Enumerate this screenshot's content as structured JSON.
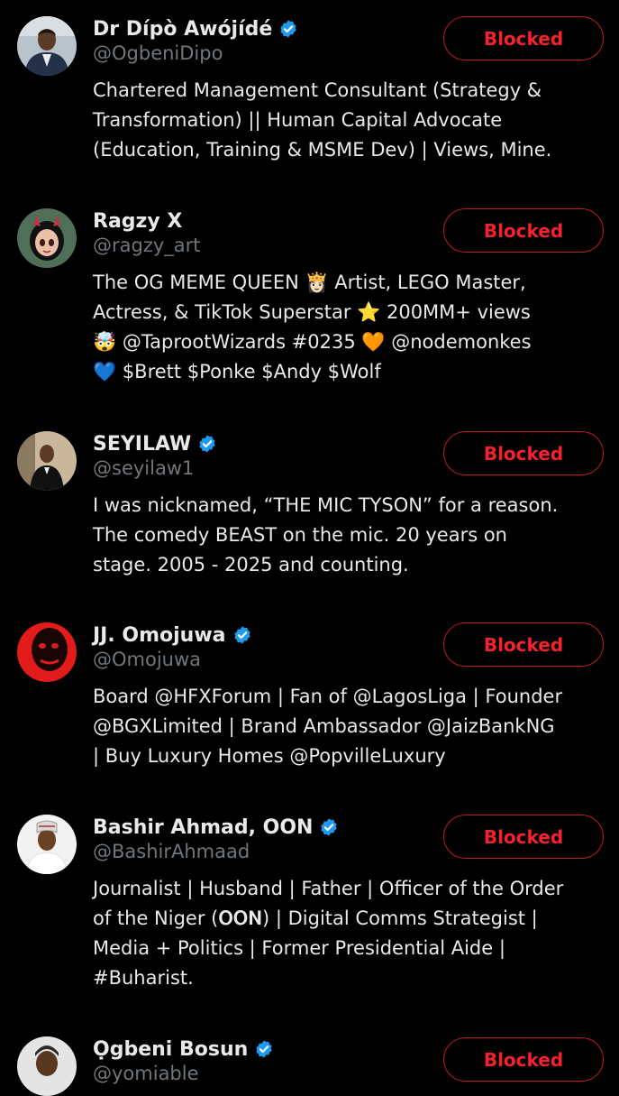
{
  "button_label": "Blocked",
  "accent_color": "#f4212e",
  "verified_color": "#1d9bf0",
  "accounts": [
    {
      "name": "Dr Dípò Awójídé",
      "handle": "@OgbeniDipo",
      "verified": true,
      "bio": "Chartered Management Consultant (Strategy &\nTransformation) || Human Capital Advocate\n(Education, Training & MSME Dev) | Views, Mine."
    },
    {
      "name": "Ragzy X",
      "handle": "@ragzy_art",
      "verified": false,
      "bio": "The OG MEME QUEEN 👸🏻 Artist, LEGO Master,\nActress, & TikTok Superstar ⭐ 200MM+ views\n🤯 @TaprootWizards #0235 🧡 @nodemonkes\n💙 $Brett $Ponke $Andy $Wolf"
    },
    {
      "name": "SEYILAW",
      "handle": "@seyilaw1",
      "verified": true,
      "bio": "I was nicknamed, “THE MIC TYSON” for a reason.\nThe comedy BEAST on the mic. 20 years on\nstage. 2005 - 2025 and counting."
    },
    {
      "name": "JJ. Omojuwa",
      "handle": "@Omojuwa",
      "verified": true,
      "bio": "Board @HFXForum | Fan of @LagosLiga | Founder\n@BGXLimited | Brand Ambassador @JaizBankNG\n| Buy Luxury Homes @PopvilleLuxury"
    },
    {
      "name": "Bashir Ahmad, OON",
      "handle": "@BashirAhmaad",
      "verified": true,
      "bio": "Journalist | Husband | Father | Officer of the Order\nof the Niger (𝐎𝐎𝐍) | Digital Comms Strategist |\nMedia + Politics | Former Presidential Aide |\n#Buharist."
    },
    {
      "name": "Ọgbeni Bosun",
      "handle": "@yomiable",
      "verified": true,
      "bio": ""
    }
  ]
}
